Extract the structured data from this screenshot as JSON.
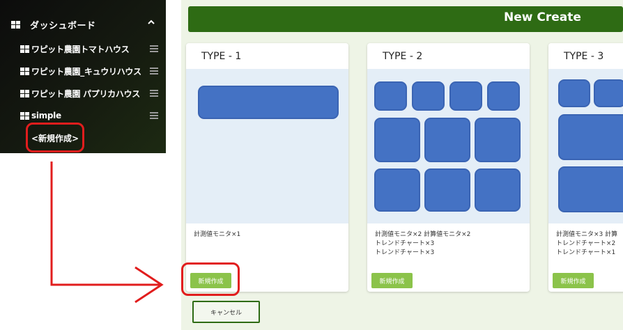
{
  "sidebar": {
    "dashboard_label": "ダッシュボード",
    "items": [
      {
        "label": "ワピット農園トマトハウス"
      },
      {
        "label": "ワピット農園_キュウリハウス"
      },
      {
        "label": "ワピット農園 パプリカハウス"
      },
      {
        "label": "simple"
      }
    ],
    "new_link": "<新規作成>"
  },
  "main": {
    "header_title": "New Create",
    "cards": [
      {
        "title": "TYPE - 1",
        "description": "計測値モニタ×1",
        "button": "新規作成"
      },
      {
        "title": "TYPE - 2",
        "description": "計測値モニタ×2 計算値モニタ×2\nトレンドチャート×3\nトレンドチャート×3",
        "button": "新規作成"
      },
      {
        "title": "TYPE - 3",
        "description": "計測値モニタ×3 計算\nトレンドチャート×2\nトレンドチャート×1",
        "button": "新規作成"
      }
    ],
    "cancel_label": "キャンセル"
  },
  "colors": {
    "header_green": "#2e6b14",
    "button_green": "#8bc34a",
    "tile_blue": "#4472c4",
    "highlight_red": "#e11d1d",
    "panel_bg": "#eef4e6"
  },
  "icons": {
    "dashboard": "grid-icon",
    "collapse": "chevron-up-icon",
    "item_handle": "menu-icon"
  }
}
